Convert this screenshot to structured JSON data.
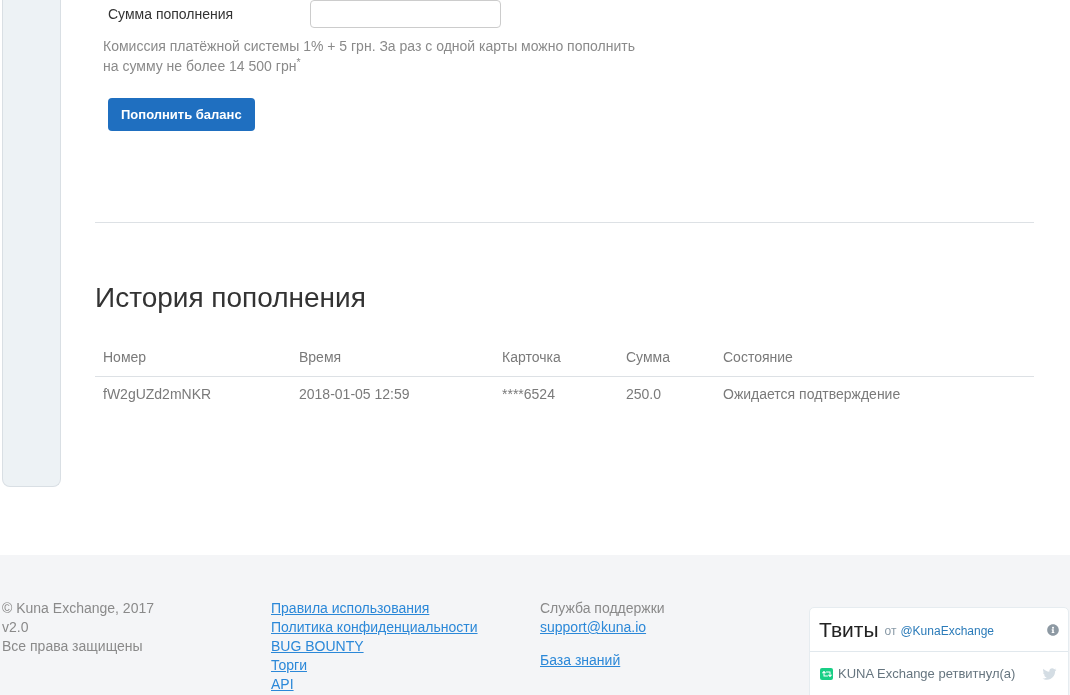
{
  "deposit_form": {
    "amount_label": "Сумма пополнения",
    "note": "Комиссия платёжной системы 1% + 5 грн. За раз с одной карты можно пополнить на сумму не более 14 500 грн$^{*}$",
    "submit_button": "Пополнить баланс"
  },
  "history": {
    "title": "История пополнения",
    "columns": [
      "Номер",
      "Время",
      "Карточка",
      "Сумма",
      "Состояние"
    ],
    "rows": [
      [
        "fW2gUZd2mNKR",
        "2018-01-05 12:59",
        "****6524",
        "250.0",
        "Ожидается подтверждение"
      ]
    ]
  },
  "footer": {
    "company": [
      "© Kuna Exchange, 2017",
      "v2.0",
      "Все права защищены"
    ],
    "links": [
      "Правила использования",
      "Политика конфиденциальности",
      "BUG BOUNTY",
      "Торги",
      "API"
    ],
    "support": {
      "label": "Служба поддержки",
      "email": "support@kuna.io",
      "knowledge_base": "База знаний"
    },
    "twitter": {
      "title": "Твиты",
      "by": "от",
      "handle": "@KunaExchange",
      "retweet": "KUNA Exchange ретвитнул(а)"
    }
  }
}
